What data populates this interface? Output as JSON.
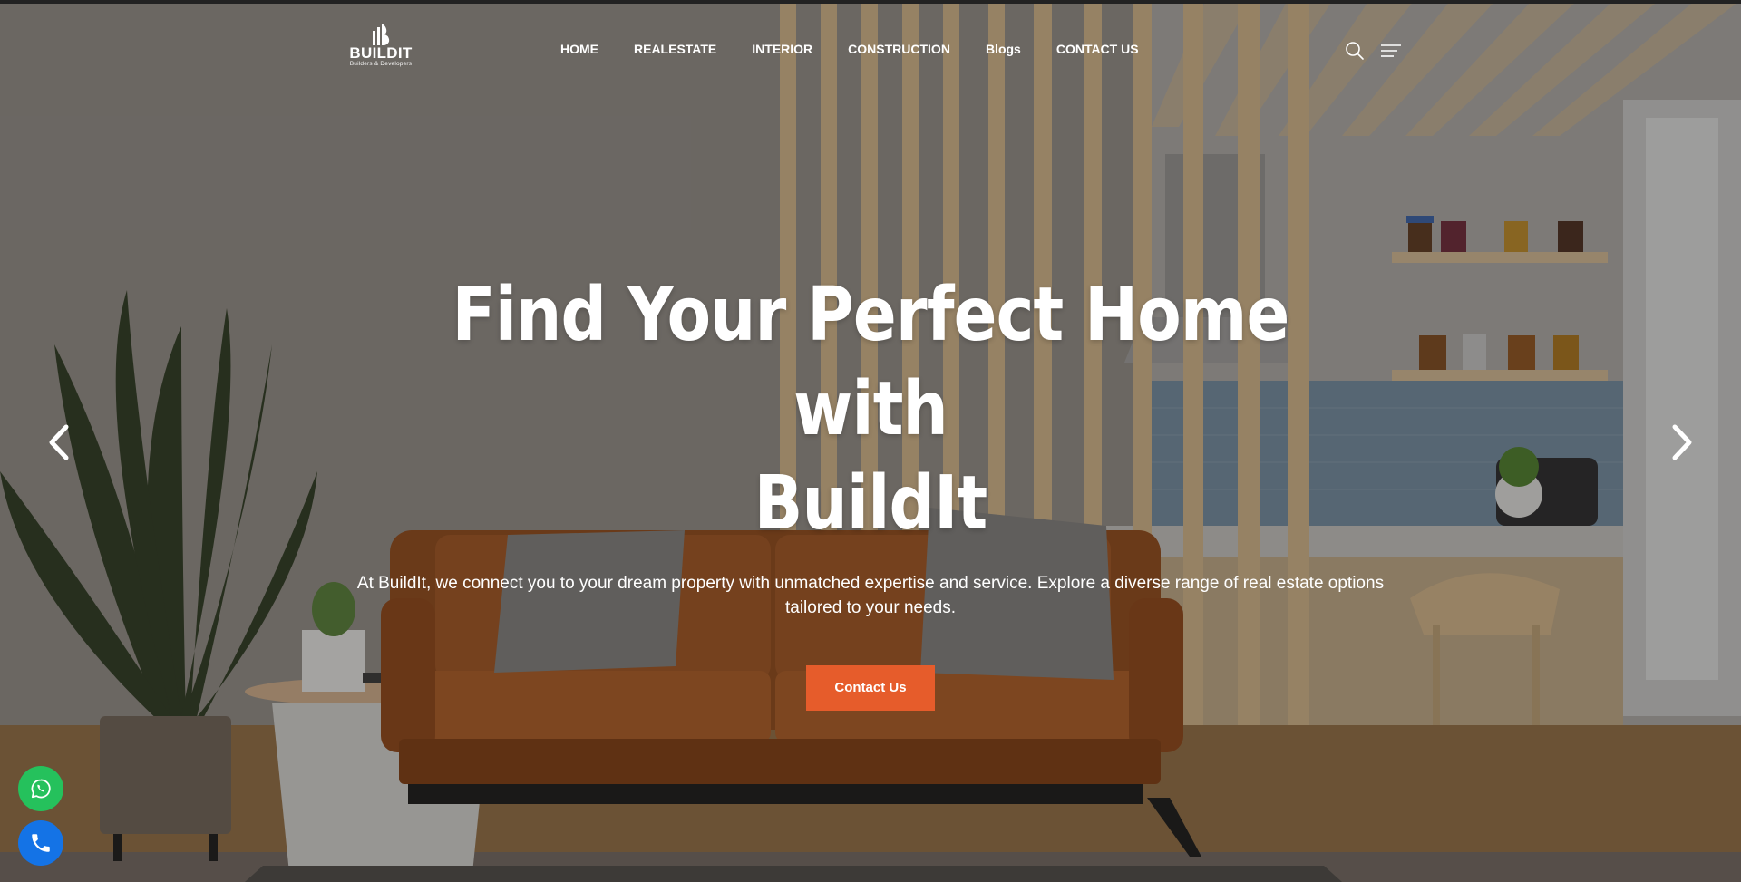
{
  "brand": {
    "name": "BUILDIT",
    "tagline": "Builders & Developers"
  },
  "nav": {
    "items": [
      {
        "label": "HOME"
      },
      {
        "label": "REALESTATE"
      },
      {
        "label": "INTERIOR"
      },
      {
        "label": "CONSTRUCTION"
      },
      {
        "label": "Blogs"
      },
      {
        "label": "CONTACT US"
      }
    ]
  },
  "header_icons": [
    "search-icon",
    "menu-icon"
  ],
  "hero": {
    "title_line1": "Find Your Perfect Home with",
    "title_line2": "BuildIt",
    "description": "At BuildIt, we connect you to your dream property with unmatched expertise and service. Explore a diverse range of real estate options tailored to your needs.",
    "cta_label": "Contact Us"
  },
  "slider": {
    "prev_icon": "chevron-left-icon",
    "next_icon": "chevron-right-icon"
  },
  "floating": {
    "whatsapp_icon": "whatsapp-icon",
    "phone_icon": "phone-icon"
  },
  "colors": {
    "accent": "#e65c2b",
    "whatsapp": "#25c15c",
    "phone": "#1473e6",
    "text": "#ffffff"
  }
}
